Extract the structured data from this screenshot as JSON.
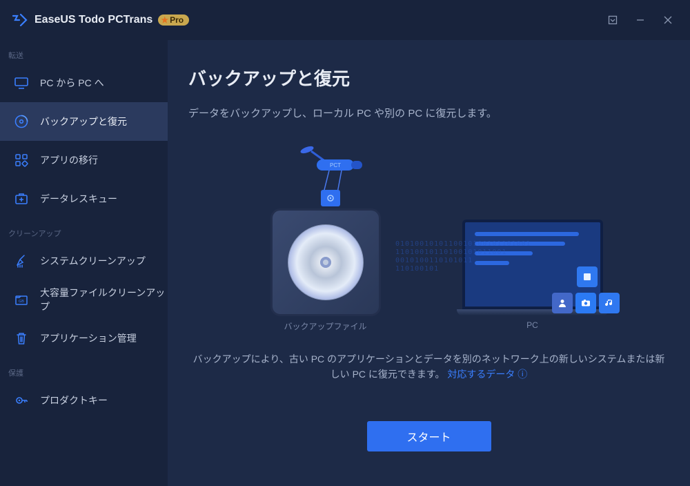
{
  "titlebar": {
    "app_name": "EaseUS Todo PCTrans",
    "badge_text": "Pro"
  },
  "sidebar": {
    "sections": [
      {
        "label": "転送",
        "items": [
          {
            "icon": "monitor",
            "label": "PC から PC へ"
          },
          {
            "icon": "disc",
            "label": "バックアップと復元"
          },
          {
            "icon": "apps",
            "label": "アプリの移行"
          },
          {
            "icon": "rescue",
            "label": "データレスキュー"
          }
        ]
      },
      {
        "label": "クリーンアップ",
        "items": [
          {
            "icon": "broom",
            "label": "システムクリーンアップ"
          },
          {
            "icon": "bigfile",
            "label": "大容量ファイルクリーンアップ"
          },
          {
            "icon": "trash",
            "label": "アプリケーション管理"
          }
        ]
      },
      {
        "label": "保護",
        "items": [
          {
            "icon": "key",
            "label": "プロダクトキー"
          }
        ]
      }
    ],
    "active_item": "バックアップと復元"
  },
  "main": {
    "title": "バックアップと復元",
    "subtitle": "データをバックアップし、ローカル PC や別の PC に復元します。",
    "caption_left": "バックアップファイル",
    "caption_right": "PC",
    "description_prefix": "バックアップにより、古い PC のアプリケーションとデータを別のネットワーク上の新しいシステムまたは新しい PC に復元できます。 ",
    "link_text": "対応するデータ ⓘ",
    "start_label": "スタート",
    "satellite_label": "PCT"
  }
}
